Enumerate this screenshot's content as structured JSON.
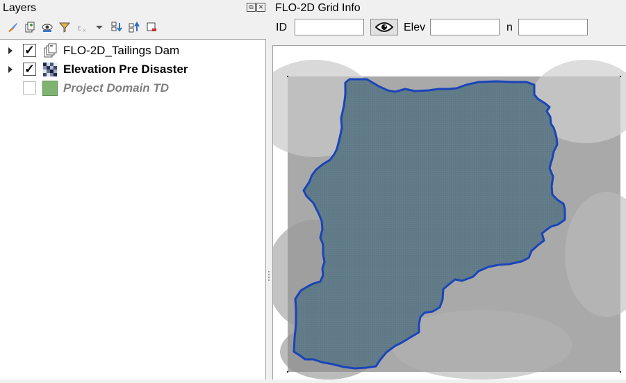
{
  "layers_panel": {
    "title": "Layers",
    "float_glyph": "⧉",
    "close_glyph": "✕",
    "toolbar": [
      {
        "name": "style-paintbrush-icon"
      },
      {
        "name": "add-group-icon"
      },
      {
        "name": "visibility-eye-icon"
      },
      {
        "name": "filter-icon"
      },
      {
        "name": "filter-expression-icon"
      },
      {
        "name": "dropdown-arrow-icon"
      },
      {
        "name": "expand-all-icon"
      },
      {
        "name": "collapse-all-icon"
      },
      {
        "name": "remove-layer-icon"
      }
    ],
    "layers": [
      {
        "label": "FLO-2D_Tailings Dam",
        "checked": "✓",
        "icon": "layer-group-icon",
        "expandable": true
      },
      {
        "label": "Elevation Pre Disaster",
        "checked": "✓",
        "icon": "raster-layer-icon",
        "expandable": true
      },
      {
        "label": "Project Domain TD",
        "checked": "",
        "icon": "polygon-layer-icon",
        "expandable": false
      }
    ]
  },
  "grid_info": {
    "title": "FLO-2D Grid Info",
    "id_label": "ID",
    "id_value": "",
    "elev_label": "Elev",
    "elev_value": "",
    "n_label": "n",
    "n_value": ""
  },
  "colors": {
    "domain_outline": "#1a44b8",
    "domain_fill": "#5b7583",
    "polygon_swatch": "#7fb372"
  }
}
